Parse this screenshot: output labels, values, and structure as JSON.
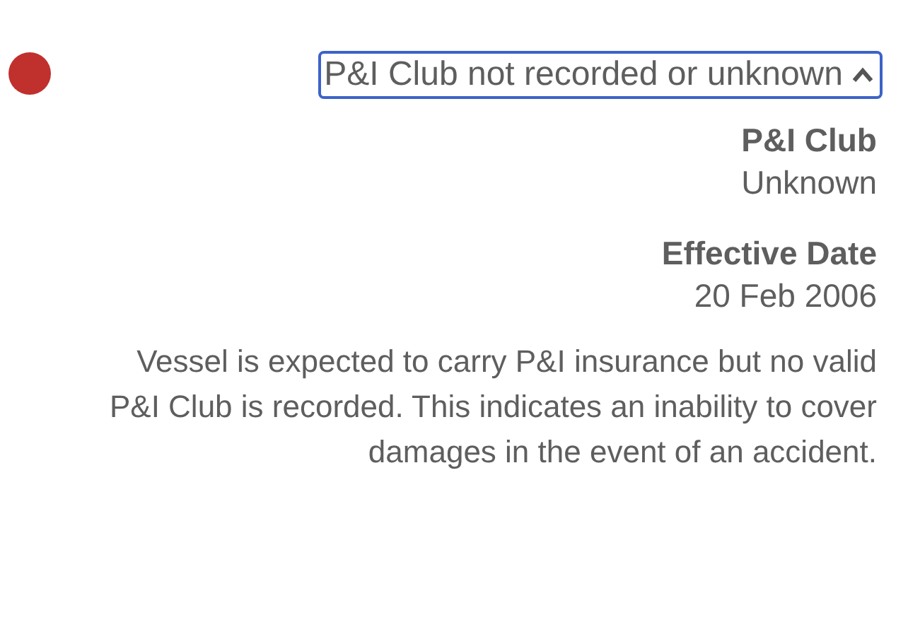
{
  "alert": {
    "title": "P&I Club not recorded or unknown",
    "expanded": true
  },
  "fields": [
    {
      "label": "P&I Club",
      "value": "Unknown"
    },
    {
      "label": "Effective Date",
      "value": "20 Feb 2006"
    }
  ],
  "description": "Vessel is expected to carry P&I insurance but no valid P&I Club is recorded. This indicates an inability to cover damages in the event of an accident."
}
